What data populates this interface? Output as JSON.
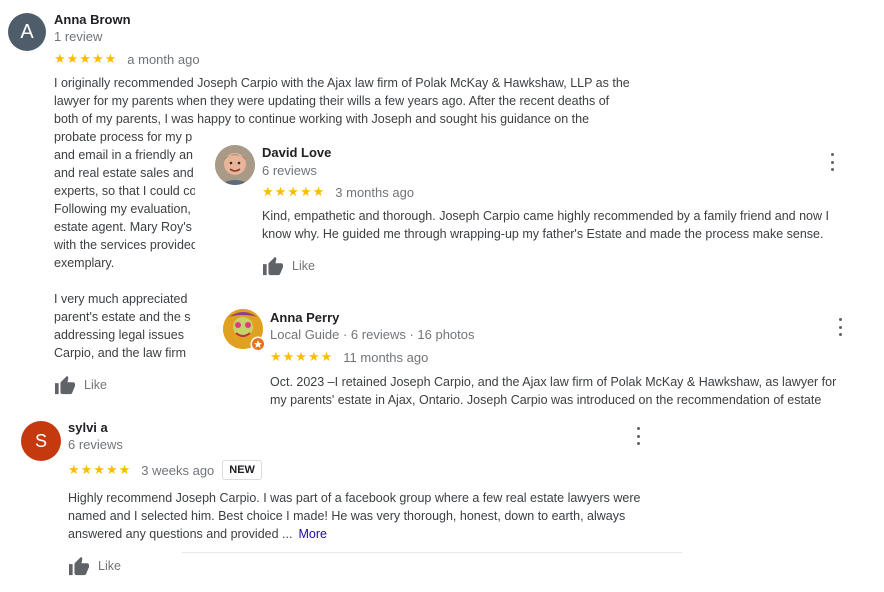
{
  "reviews": [
    {
      "author": "Anna Brown",
      "initial": "A",
      "meta": "1 review",
      "stars": "★★★★★",
      "ago": "a month ago",
      "body_lines": [
        "I originally recommended Joseph Carpio with the Ajax law firm of Polak McKay & Hawkshaw, LLP as the",
        "lawyer for my parents when they were updating their wills a few years ago. After the recent deaths of",
        "both of my parents, I was happy to continue working with Joseph and sought his guidance on the",
        "probate process for my p",
        "and email in a friendly an",
        "and real estate sales and",
        "experts, so that I could co",
        "Following my evaluation,",
        "estate agent. Mary Roy's",
        "with the services provided",
        "exemplary."
      ],
      "body_lines_2": [
        "I very much appreciated",
        "parent's estate and the s",
        "addressing legal issues",
        "Carpio, and the law firm"
      ],
      "like": "Like",
      "avatar_color": "#4f5d6b"
    },
    {
      "author": "David Love",
      "meta": "6 reviews",
      "stars": "★★★★★",
      "ago": "3 months ago",
      "body_lines": [
        "Kind, empathetic and thorough. Joseph Carpio came highly  recommended by a family friend and now I",
        "know why.  He guided me through wrapping-up my father's Estate and made the process make sense."
      ],
      "like": "Like"
    },
    {
      "author": "Anna Perry",
      "meta": "Local Guide · 6 reviews · 16 photos",
      "stars": "★★★★★",
      "ago": "11 months ago",
      "body_lines": [
        "Oct. 2023 –I retained Joseph Carpio, and the Ajax law firm of Polak McKay & Hawkshaw, as lawyer for",
        "my parents' estate in Ajax, Ontario. Joseph Carpio was introduced on the recommendation of estate"
      ]
    },
    {
      "author": "sylvi a",
      "initial": "S",
      "meta": "6 reviews",
      "stars": "★★★★★",
      "ago": "3 weeks ago",
      "badge": "NEW",
      "body_lines": [
        "Highly recommend Joseph Carpio.  I was part of a facebook group where a few real estate lawyers were",
        "named and I selected him.  Best choice I made!  He was very thorough, honest, down to earth, always",
        "answered any questions and provided ..."
      ],
      "more": "More",
      "like": "Like",
      "avatar_color": "#c5390f"
    }
  ]
}
